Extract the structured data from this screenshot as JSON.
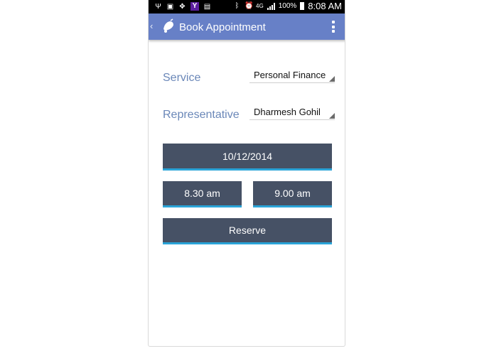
{
  "status_bar": {
    "battery_text": "100%",
    "time": "8:08 AM",
    "network_label": "4G"
  },
  "app_bar": {
    "title": "Book Appointment"
  },
  "form": {
    "service_label": "Service",
    "service_value": "Personal Finance",
    "representative_label": "Representative",
    "representative_value": "Dharmesh Gohil",
    "date_button": "10/12/2014",
    "start_time_button": "8.30 am",
    "end_time_button": "9.00 am",
    "reserve_button": "Reserve"
  },
  "colors": {
    "app_bar": "#6780c7",
    "button": "#465165",
    "button_underline": "#2aa4d8",
    "label": "#6a87b8"
  }
}
